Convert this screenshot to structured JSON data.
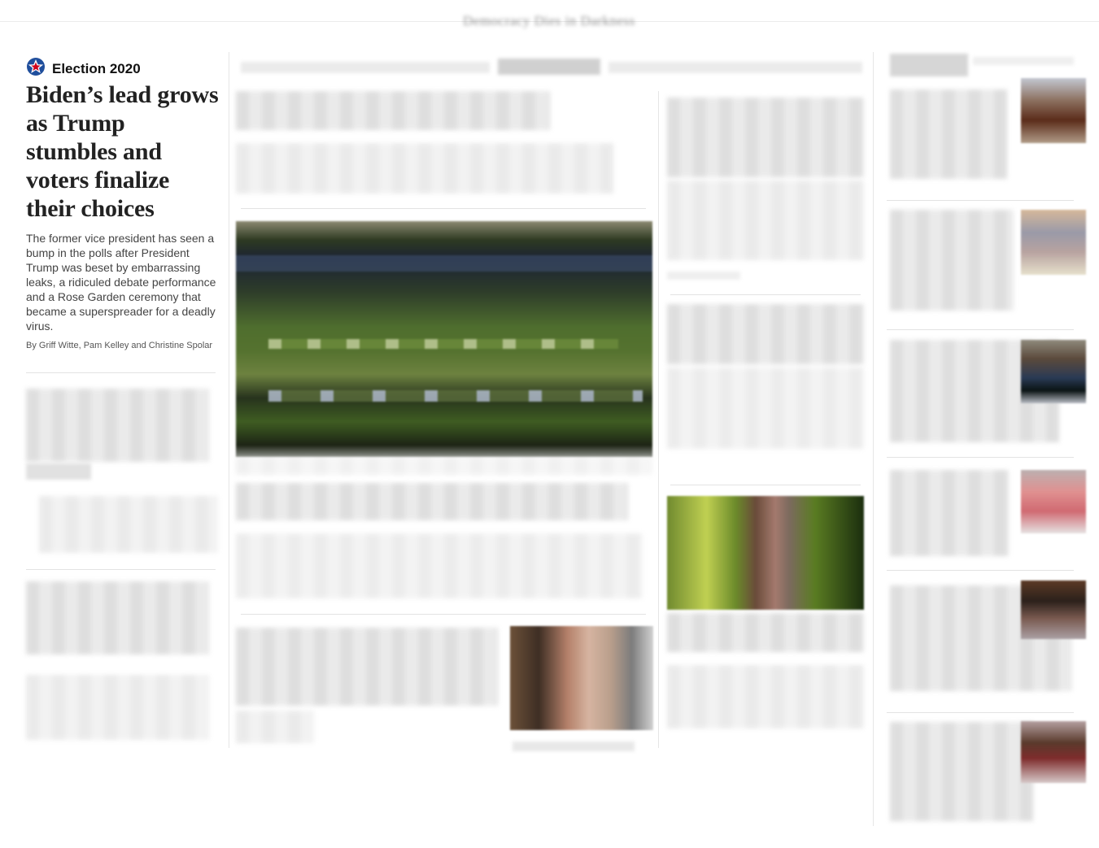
{
  "topbar": {
    "label": "Democracy Dies in Darkness"
  },
  "lead_story": {
    "kicker": "Election 2020",
    "kicker_icon": "election-star-icon",
    "headline": "Biden’s lead grows as Trump stumbles and voters finalize their choices",
    "blurb": "The former vice president has seen a bump in the polls after President Trump was beset by embarrassing leaks, a ridiculed debate performance and a Rose Garden ceremony that became a superspreader for a deadly virus.",
    "byline": "By Griff Witte, Pam Kelley and Christine Spolar"
  },
  "colors": {
    "headline": "#222222",
    "kicker_star_red": "#d0021b",
    "kicker_star_blue": "#1f4e9c",
    "blur_gray": "#dcdcdc"
  }
}
